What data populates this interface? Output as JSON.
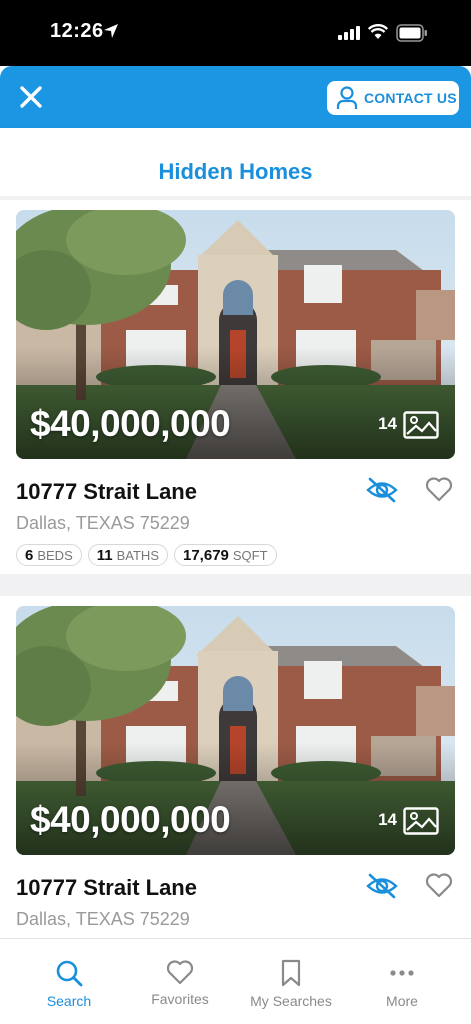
{
  "status_bar": {
    "time": "12:26"
  },
  "header": {
    "contact_label": "CONTACT US"
  },
  "page_title": "Hidden Homes",
  "listings": [
    {
      "price": "$40,000,000",
      "photo_count": "14",
      "address": "10777 Strait Lane",
      "city": "Dallas, TEXAS 75229",
      "beds": "6",
      "beds_label": "BEDS",
      "baths": "11",
      "baths_label": "BATHS",
      "sqft": "17,679",
      "sqft_label": "SQFT"
    },
    {
      "price": "$40,000,000",
      "photo_count": "14",
      "address": "10777 Strait Lane",
      "city": "Dallas, TEXAS 75229"
    }
  ],
  "tabs": [
    {
      "label": "Search",
      "icon": "search-icon",
      "active": true
    },
    {
      "label": "Favorites",
      "icon": "heart-icon"
    },
    {
      "label": "My Searches",
      "icon": "bookmark-icon"
    },
    {
      "label": "More",
      "icon": "more-icon"
    }
  ],
  "colors": {
    "brand": "#1a96e3",
    "accent_text": "#1a8fdc",
    "muted": "#9a9a9a"
  }
}
